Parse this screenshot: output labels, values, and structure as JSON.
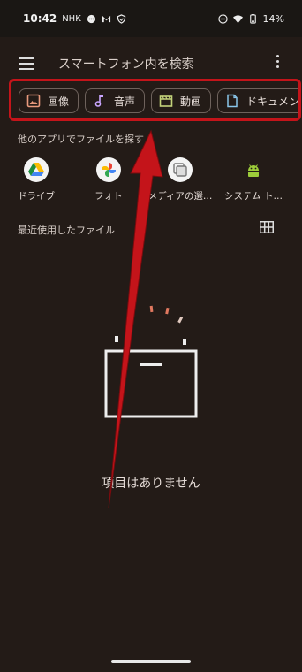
{
  "status": {
    "time": "10:42",
    "notif_icons": [
      "NHK",
      "chat-icon",
      "gmail-icon",
      "shield-icon"
    ],
    "battery": "14%"
  },
  "search": {
    "placeholder": "スマートフォン内を検索"
  },
  "chips": [
    {
      "label": "画像",
      "icon": "image-icon",
      "color": "#e89a7d"
    },
    {
      "label": "音声",
      "icon": "music-note-icon",
      "color": "#c9a6ff"
    },
    {
      "label": "動画",
      "icon": "movie-icon",
      "color": "#c3d27a"
    },
    {
      "label": "ドキュメント",
      "icon": "document-icon",
      "color": "#8ac6ea"
    }
  ],
  "other_apps": {
    "title": "他のアプリでファイルを探す",
    "items": [
      {
        "label": "ドライブ",
        "icon": "google-drive-icon"
      },
      {
        "label": "フォト",
        "icon": "google-photos-icon"
      },
      {
        "label": "メディアの選…",
        "icon": "media-picker-icon"
      },
      {
        "label": "システム ト…",
        "icon": "android-icon"
      }
    ]
  },
  "recent": {
    "title": "最近使用したファイル"
  },
  "empty_state": {
    "text": "項目はありません"
  },
  "colors": {
    "background": "#231b17",
    "highlight": "#c4141a"
  }
}
